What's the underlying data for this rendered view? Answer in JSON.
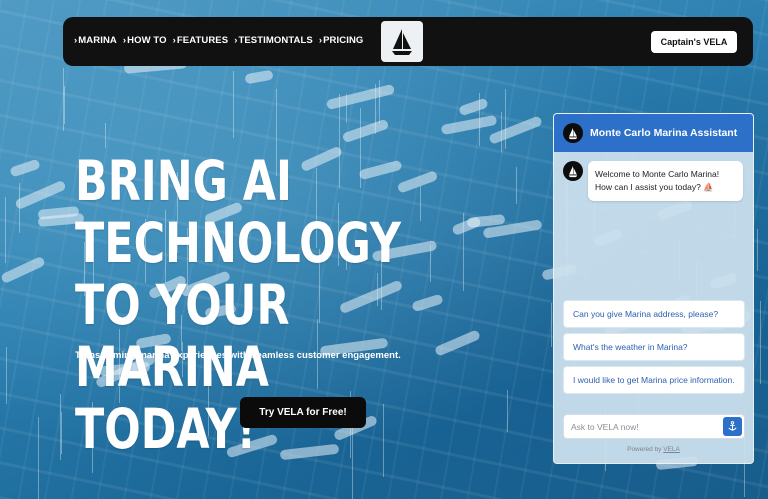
{
  "nav": {
    "links": [
      {
        "chevron": "›",
        "label": "MARINA"
      },
      {
        "chevron": "›",
        "label": "HOW TO"
      },
      {
        "chevron": "›",
        "label": "FEATURES"
      },
      {
        "chevron": "›",
        "label": "TESTIMONTALS"
      },
      {
        "chevron": "›",
        "label": "PRICING"
      }
    ],
    "logo_icon": "sailboat-logo-icon",
    "cta_label": "Captain's VELA"
  },
  "hero": {
    "title_lines": [
      "BRING AI",
      "TECHNOLOGY TO YOUR",
      "MARINA TODAY!"
    ],
    "subtitle": "Transforming marina experiences with seamless customer engagement.",
    "cta_label": "Try VELA for Free!"
  },
  "chat": {
    "title": "Monte Carlo Marina Assistant",
    "welcome_message": "Welcome to Monte Carlo Marina! How can I assist you today? ⛵",
    "suggestions": [
      "Can you give Marina address, please?",
      "What's the weather in Marina?",
      "I would like to get Marina price information."
    ],
    "input_placeholder": "Ask to VELA now!",
    "powered_prefix": "Powered by",
    "powered_brand": "VELA"
  },
  "colors": {
    "navbar_bg": "#111111",
    "chat_header": "#2d70c9",
    "cta_bg": "#0b0b0b",
    "suggestion_text": "#2d5fb0"
  }
}
